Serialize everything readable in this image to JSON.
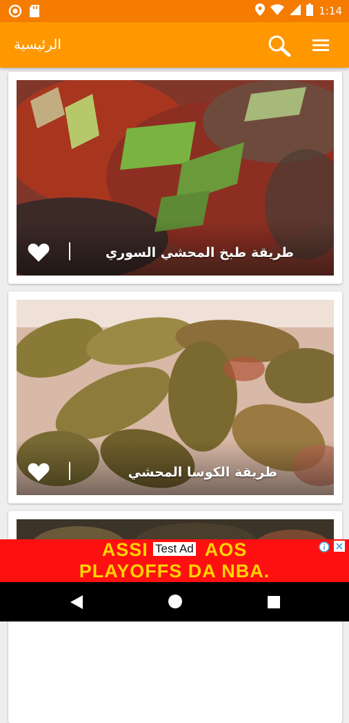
{
  "status_bar": {
    "time": "1:14"
  },
  "app_bar": {
    "title": "الرئيسية"
  },
  "recipes": [
    {
      "title": "طريقة طبخ المحشي السوري",
      "favorited": false
    },
    {
      "title": "طريقة الكوسا المحشي",
      "favorited": false
    },
    {
      "title": "",
      "favorited": false
    }
  ],
  "ad": {
    "label": "Test Ad",
    "text_line1": "ASSI",
    "text_line1_end": "AOS",
    "text_line2": "PLAYOFFS DA NBA."
  },
  "colors": {
    "status_bar": "#f57c00",
    "app_bar": "#ff9800",
    "ad_background": "#ff1010",
    "ad_text": "#ffd400"
  },
  "icons": [
    "search-icon",
    "menu-icon",
    "heart-icon",
    "back-icon",
    "home-icon",
    "recents-icon",
    "ad-info-icon",
    "ad-close-icon"
  ]
}
